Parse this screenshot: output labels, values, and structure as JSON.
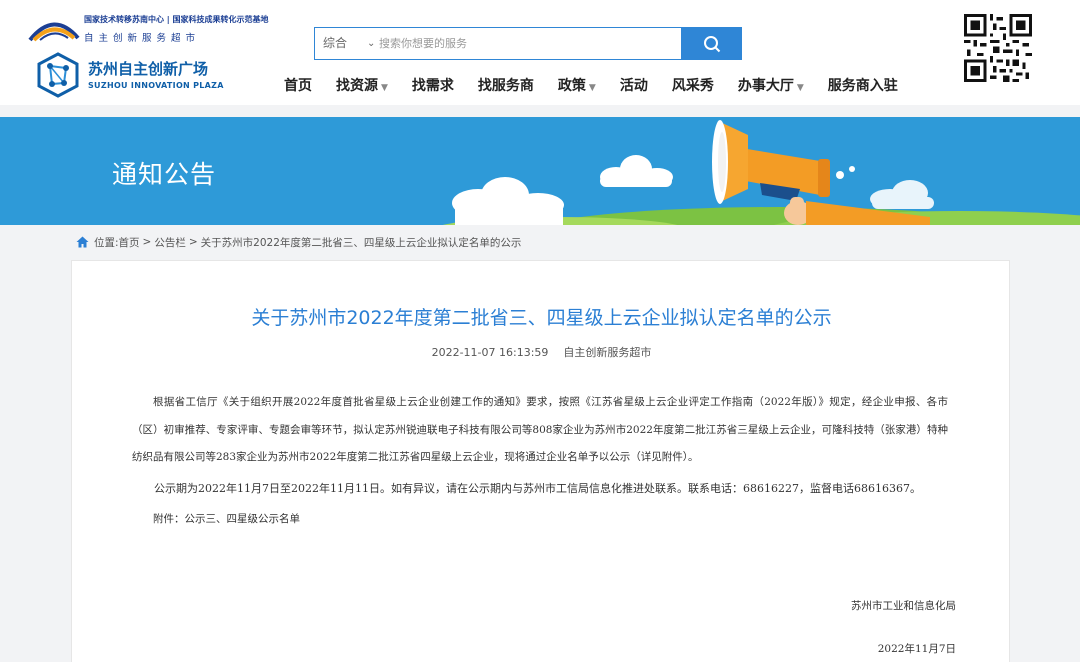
{
  "header": {
    "logo_top_line1": "国家技术转移苏南中心 | 国家科技成果转化示范基地",
    "logo_top_line2": "自主创新服务超市",
    "logo_main_cn": "苏州自主创新广场",
    "logo_main_en": "SUZHOU INNOVATION PLAZA"
  },
  "search": {
    "category": "综合",
    "placeholder": "搜索你想要的服务"
  },
  "nav": [
    {
      "label": "首页",
      "arrow": ""
    },
    {
      "label": "找资源",
      "arrow": "▼"
    },
    {
      "label": "找需求",
      "arrow": ""
    },
    {
      "label": "找服务商",
      "arrow": ""
    },
    {
      "label": "政策",
      "arrow": "▼"
    },
    {
      "label": "活动",
      "arrow": ""
    },
    {
      "label": "风采秀",
      "arrow": ""
    },
    {
      "label": "办事大厅",
      "arrow": "▼"
    },
    {
      "label": "服务商入驻",
      "arrow": ""
    }
  ],
  "banner": {
    "title": "通知公告"
  },
  "breadcrumb": {
    "prefix": "位置:",
    "home": "首页",
    "section": "公告栏",
    "current": "关于苏州市2022年度第二批省三、四星级上云企业拟认定名单的公示",
    "separator": ">"
  },
  "article": {
    "title": "关于苏州市2022年度第二批省三、四星级上云企业拟认定名单的公示",
    "datetime": "2022-11-07 16:13:59",
    "source": "自主创新服务超市",
    "paragraph1": "根据省工信厅《关于组织开展2022年度首批省星级上云企业创建工作的通知》要求，按照《江苏省星级上云企业评定工作指南（2022年版）》规定，经企业申报、各市（区）初审推荐、专家评审、专题会审等环节，拟认定苏州锐迪联电子科技有限公司等808家企业为苏州市2022年度第二批江苏省三星级上云企业，可隆科技特（张家港）特种纺织品有限公司等283家企业为苏州市2022年度第二批江苏省四星级上云企业，现将通过企业名单予以公示（详见附件）。",
    "paragraph2": "公示期为2022年11月7日至2022年11月11日。如有异议，请在公示期内与苏州市工信局信息化推进处联系。联系电话：68616227，监督电话68616367。",
    "attachment": "附件：公示三、四星级公示名单",
    "signature_org": "苏州市工业和信息化局",
    "signature_date": "2022年11月7日"
  },
  "colors": {
    "banner_blue": "#2e9ad8",
    "search_blue": "#2f86d6",
    "title_blue": "#2b7fd4",
    "brand_blue": "#0f5fa8"
  },
  "icons": [
    "arc-logo-icon",
    "hexagon-network-logo-icon",
    "search-icon",
    "qr-code-icon",
    "home-icon",
    "megaphone-icon",
    "cloud-icon"
  ]
}
